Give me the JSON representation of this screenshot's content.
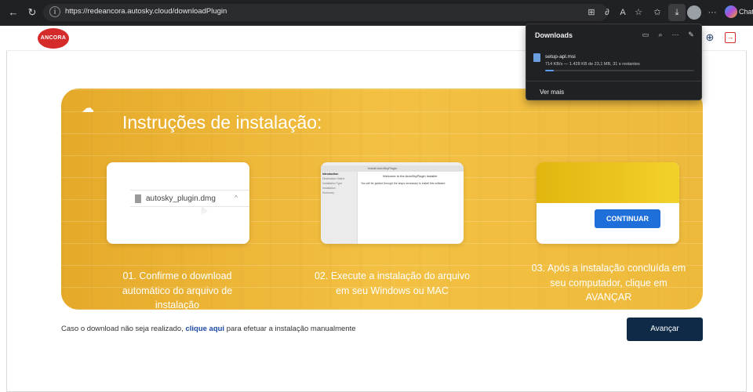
{
  "browser": {
    "url": "https://redeancora.autosky.cloud/downloadPlugin",
    "copilot_label": "Chat",
    "icons": [
      "back-icon",
      "refresh-icon",
      "site-info-icon",
      "apps-icon",
      "read-aloud-icon",
      "text-size-icon",
      "favorite-icon",
      "favorites-bar-icon",
      "downloads-icon",
      "profile-icon",
      "more-icon",
      "copilot-icon"
    ]
  },
  "downloads_panel": {
    "title": "Downloads",
    "file_name": "setup-apl.msi",
    "status": "714 KB/s — 1.428 KB de 23,1 MB, 31 s restantes",
    "progress": 0.06,
    "see_more": "Ver mais"
  },
  "header": {
    "logo_text": "ANCORA"
  },
  "banner": {
    "title": "Instruções de instalação:",
    "steps": [
      {
        "text": "01. Confirme o download automático do arquivo de instalação"
      },
      {
        "text": "02. Execute a instalação do arquivo em seu Windows ou MAC"
      },
      {
        "text": "03. Após a instalação concluída em seu computador, clique em AVANÇAR"
      }
    ],
    "card1": {
      "file_name": "autosky_plugin.dmg",
      "caret": "^"
    },
    "card2": {
      "window_title": "Install AutoSkyPlugin",
      "welcome": "Welcome to the AutoSkyPlugin Installer",
      "body": "You will be guided through the steps necessary to install this software.",
      "sidebar": [
        "Introduction",
        "Destination Select",
        "Installation Type",
        "Installation",
        "Summary"
      ]
    },
    "card3": {
      "button": "CONTINUAR"
    }
  },
  "footer": {
    "fallback_pre": "Caso o download não seja realizado, ",
    "fallback_link": "clique aqui",
    "fallback_post": " para efetuar a instalação manualmente",
    "next_button": "Avançar"
  }
}
